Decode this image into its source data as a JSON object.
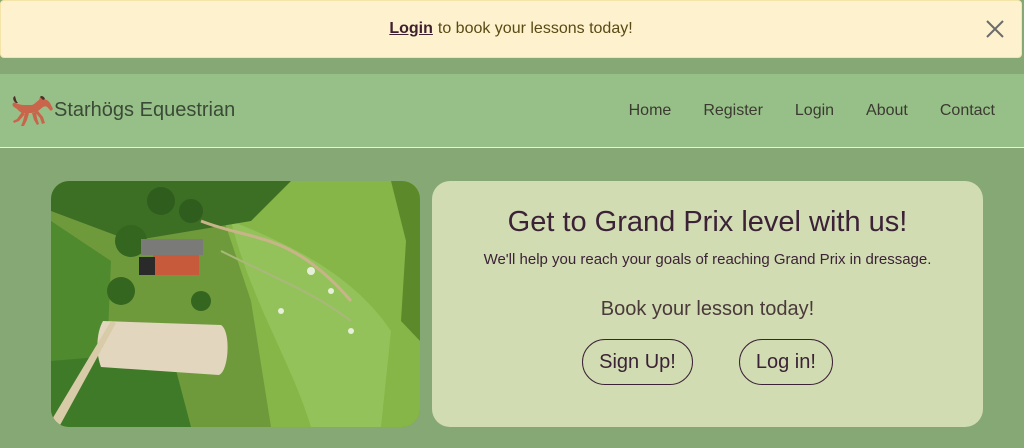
{
  "alert": {
    "link_label": "Login",
    "message": "to book your lessons today!"
  },
  "navbar": {
    "brand": "Starhögs Equestrian",
    "links": [
      "Home",
      "Register",
      "Login",
      "About",
      "Contact"
    ]
  },
  "hero": {
    "title": "Get to Grand Prix level with us!",
    "subtitle": "We'll help you reach your goals of reaching Grand Prix in dressage.",
    "cta": "Book your lesson today!",
    "signup_label": "Sign Up!",
    "login_label": "Log in!"
  },
  "colors": {
    "page_bg": "#86a874",
    "navbar_bg": "#97c089",
    "alert_bg": "#fdf2cd",
    "card_bg": "#d2dcb3",
    "text_dark": "#3b2236",
    "horse": "#c9654a"
  },
  "icons": [
    "horse-logo-icon",
    "close-icon"
  ]
}
